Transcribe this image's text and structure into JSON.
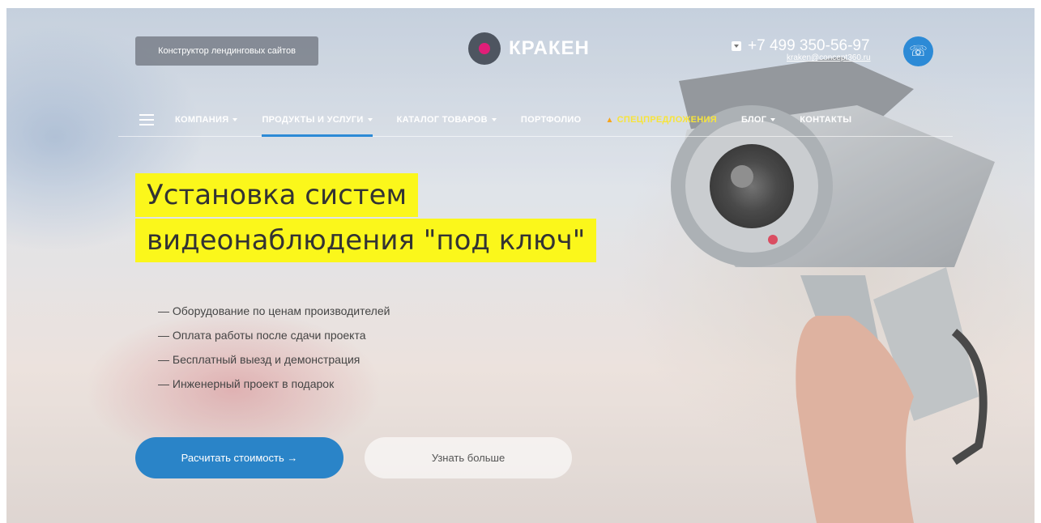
{
  "header": {
    "builder_button": "Конструктор лендинговых сайтов",
    "logo_text": "КРАКЕН",
    "phone": "+7 499 350-56-97",
    "email": "kraken@concept360.ru"
  },
  "nav": {
    "items": [
      {
        "label": "КОМПАНИЯ",
        "has_dropdown": true
      },
      {
        "label": "ПРОДУКТЫ И УСЛУГИ",
        "has_dropdown": true,
        "active": true
      },
      {
        "label": "КАТАЛОГ ТОВАРОВ",
        "has_dropdown": true
      },
      {
        "label": "ПОРТФОЛИО",
        "has_dropdown": false
      },
      {
        "label": "СПЕЦПРЕДЛОЖЕНИЯ",
        "has_dropdown": false,
        "icon": "fire-icon"
      },
      {
        "label": "БЛОГ",
        "has_dropdown": true
      },
      {
        "label": "КОНТАКТЫ",
        "has_dropdown": false
      }
    ]
  },
  "hero": {
    "title_line1": "Установка систем",
    "title_line2": "видеонаблюдения \"под ключ\"",
    "features": [
      "— Оборудование по ценам производителей",
      "— Оплата работы после сдачи проекта",
      "— Бесплатный выезд и демонстрация",
      "— Инженерный проект в подарок"
    ],
    "primary_button": "Расчитать стоимость →",
    "secondary_button": "Узнать больше"
  },
  "colors": {
    "accent": "#2c8ad6",
    "highlight": "#fbf71b",
    "special": "#f7e43b"
  }
}
